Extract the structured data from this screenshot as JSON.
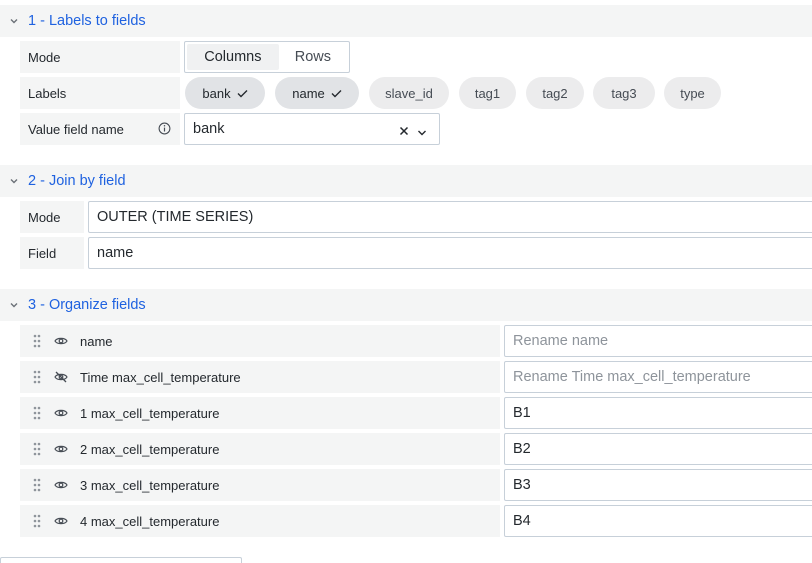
{
  "sections": {
    "labels_to_fields": {
      "title": "1 - Labels to fields",
      "mode_label": "Mode",
      "mode_options": [
        "Columns",
        "Rows"
      ],
      "mode_selected": "Columns",
      "labels_label": "Labels",
      "labels": [
        {
          "name": "bank",
          "selected": true
        },
        {
          "name": "name",
          "selected": true
        },
        {
          "name": "slave_id",
          "selected": false
        },
        {
          "name": "tag1",
          "selected": false
        },
        {
          "name": "tag2",
          "selected": false
        },
        {
          "name": "tag3",
          "selected": false
        },
        {
          "name": "type",
          "selected": false
        }
      ],
      "value_field_label": "Value field name",
      "value_field_value": "bank"
    },
    "join_by_field": {
      "title": "2 - Join by field",
      "mode_label": "Mode",
      "mode_value": "OUTER (TIME SERIES)",
      "field_label": "Field",
      "field_value": "name"
    },
    "organize_fields": {
      "title": "3 - Organize fields",
      "fields": [
        {
          "name": "name",
          "visible": true,
          "rename_value": "",
          "rename_placeholder": "Rename name"
        },
        {
          "name": "Time max_cell_temperature",
          "visible": false,
          "rename_value": "",
          "rename_placeholder": "Rename Time max_cell_temperature"
        },
        {
          "name": "1 max_cell_temperature",
          "visible": true,
          "rename_value": "B1",
          "rename_placeholder": ""
        },
        {
          "name": "2 max_cell_temperature",
          "visible": true,
          "rename_value": "B2",
          "rename_placeholder": ""
        },
        {
          "name": "3 max_cell_temperature",
          "visible": true,
          "rename_value": "B3",
          "rename_placeholder": ""
        },
        {
          "name": "4 max_cell_temperature",
          "visible": true,
          "rename_value": "B4",
          "rename_placeholder": ""
        }
      ]
    }
  },
  "icons": {
    "section_toggle": "chevron-down-icon",
    "label_selected": "check-icon",
    "info": "info-circle-icon",
    "clear": "close-icon",
    "dropdown": "chevron-down-icon",
    "drag": "drag-handle-icon",
    "visible": "eye-icon",
    "hidden": "eye-slash-icon"
  },
  "colors": {
    "accent": "#1f62e0",
    "row_background": "#f4f5f5",
    "border": "#c7d0d9"
  }
}
